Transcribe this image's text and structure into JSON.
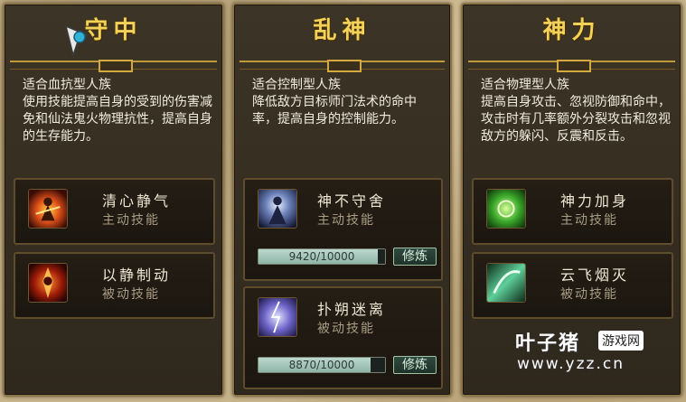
{
  "panels": [
    {
      "title": "守中",
      "desc": "适合血抗型人族\n使用技能提高自身的受到的伤害减免和仙法鬼火物理抗性，提高自身的生存能力。",
      "skills": [
        {
          "name": "清心静气",
          "type": "主动技能",
          "icon": "flame-figure-icon"
        },
        {
          "name": "以静制动",
          "type": "被动技能",
          "icon": "flame-sword-icon"
        }
      ]
    },
    {
      "title": "乱神",
      "desc": "适合控制型人族\n降低敌方目标师门法术的命中率，提高自身的控制能力。",
      "skills": [
        {
          "name": "神不守舍",
          "type": "主动技能",
          "icon": "spirit-figure-icon",
          "progress_text": "9420/10000",
          "progress_fraction": 0.942,
          "train_label": "修炼"
        },
        {
          "name": "扑朔迷离",
          "type": "被动技能",
          "icon": "lightning-mist-icon",
          "progress_text": "8870/10000",
          "progress_fraction": 0.887,
          "train_label": "修炼"
        }
      ]
    },
    {
      "title": "神力",
      "desc": "适合物理型人族\n提高自身攻击、忽视防御和命中，攻击时有几率额外分裂攻击和忽视敌方的躲闪、反震和反击。",
      "skills": [
        {
          "name": "神力加身",
          "type": "主动技能",
          "icon": "green-power-icon"
        },
        {
          "name": "云飞烟灭",
          "type": "被动技能",
          "icon": "green-blade-icon"
        }
      ]
    }
  ],
  "watermark": {
    "brand": "叶子猪",
    "badge": "游戏网",
    "url": "www.yzz.cn"
  },
  "colors": {
    "title_gold": "#f3d25a",
    "panel_bg": "#3c3426",
    "progress_fill": "#bcd8cf"
  }
}
